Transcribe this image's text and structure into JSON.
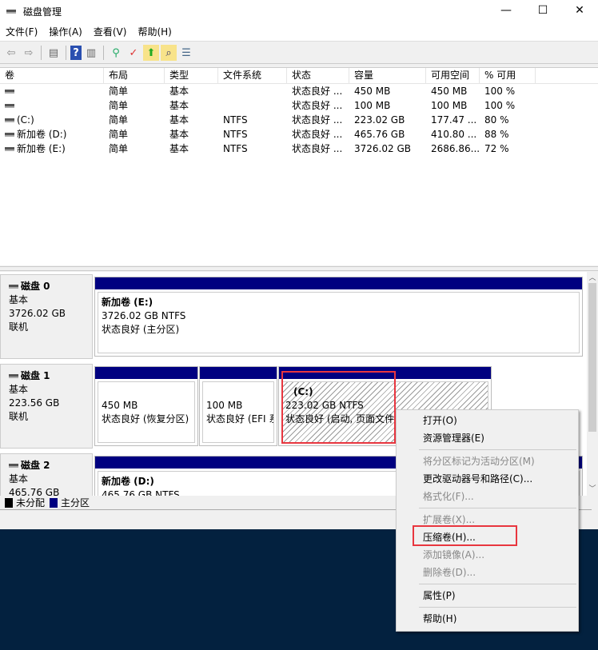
{
  "window": {
    "title": "磁盘管理",
    "min": "—",
    "max": "☐",
    "close": "✕"
  },
  "menu": [
    "文件(F)",
    "操作(A)",
    "查看(V)",
    "帮助(H)"
  ],
  "toolbar": {
    "back": "⇦",
    "forward": "⇨",
    "pane": "▤",
    "help": "?",
    "pane2": "▥",
    "connect": "⚲",
    "check": "✓",
    "up": "⬆",
    "search": "⌕",
    "props": "☰"
  },
  "volumes": {
    "headers": [
      "卷",
      "布局",
      "类型",
      "文件系统",
      "状态",
      "容量",
      "可用空间",
      "% 可用"
    ],
    "rows": [
      [
        "",
        "简单",
        "基本",
        "",
        "状态良好 ...",
        "450 MB",
        "450 MB",
        "100 %"
      ],
      [
        "",
        "简单",
        "基本",
        "",
        "状态良好 ...",
        "100 MB",
        "100 MB",
        "100 %"
      ],
      [
        "(C:)",
        "简单",
        "基本",
        "NTFS",
        "状态良好 ...",
        "223.02 GB",
        "177.47 ...",
        "80 %"
      ],
      [
        "新加卷 (D:)",
        "简单",
        "基本",
        "NTFS",
        "状态良好 ...",
        "465.76 GB",
        "410.80 ...",
        "88 %"
      ],
      [
        "新加卷 (E:)",
        "简单",
        "基本",
        "NTFS",
        "状态良好 ...",
        "3726.02 GB",
        "2686.86...",
        "72 %"
      ]
    ]
  },
  "disks": [
    {
      "name": "磁盘 0",
      "type": "基本",
      "size": "3726.02 GB",
      "status": "联机",
      "parts": [
        {
          "title": "新加卷  (E:)",
          "size": "3726.02 GB NTFS",
          "status": "状态良好 (主分区)"
        }
      ]
    },
    {
      "name": "磁盘 1",
      "type": "基本",
      "size": "223.56 GB",
      "status": "联机",
      "parts": [
        {
          "title": "",
          "size": "450 MB",
          "status": "状态良好 (恢复分区)"
        },
        {
          "title": "",
          "size": "100 MB",
          "status": "状态良好 (EFI 系"
        },
        {
          "title": "(C:)",
          "size": "223.02 GB NTFS",
          "status": "状态良好 (启动, 页面文件,"
        }
      ]
    },
    {
      "name": "磁盘 2",
      "type": "基本",
      "size": "465.76 GB",
      "status": "",
      "parts": [
        {
          "title": "新加卷  (D:)",
          "size": "465.76 GB NTFS",
          "status": ""
        }
      ]
    }
  ],
  "legend": [
    {
      "label": "未分配",
      "color": "#000000"
    },
    {
      "label": "主分区",
      "color": "#000080"
    }
  ],
  "context_menu": [
    {
      "label": "打开(O)",
      "enabled": true
    },
    {
      "label": "资源管理器(E)",
      "enabled": true
    },
    {
      "label": "将分区标记为活动分区(M)",
      "enabled": false
    },
    {
      "label": "更改驱动器号和路径(C)...",
      "enabled": true
    },
    {
      "label": "格式化(F)...",
      "enabled": false
    },
    {
      "label": "扩展卷(X)...",
      "enabled": false
    },
    {
      "label": "压缩卷(H)...",
      "enabled": true
    },
    {
      "label": "添加镜像(A)...",
      "enabled": false
    },
    {
      "label": "删除卷(D)...",
      "enabled": false
    },
    {
      "label": "属性(P)",
      "enabled": true
    },
    {
      "label": "帮助(H)",
      "enabled": true
    }
  ]
}
